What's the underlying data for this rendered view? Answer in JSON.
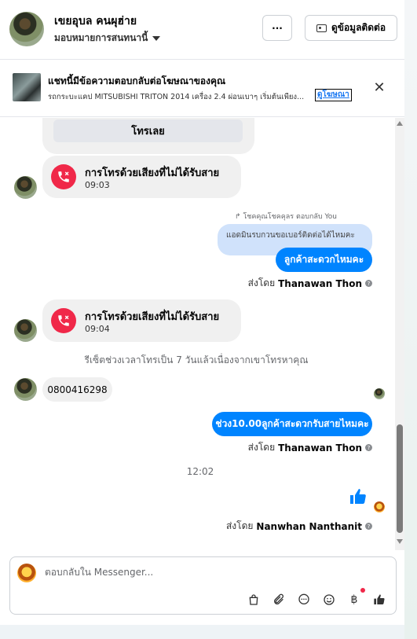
{
  "header": {
    "name": "เขยอุบล คนผุฮ่าย",
    "status": "มอบหมายการสนทนานี้",
    "more_label": "···",
    "contact_label": "ดูข้อมูลติดต่อ"
  },
  "ad_banner": {
    "title": "แชทนี้มีข้อความตอบกลับต่อโฆษณาของคุณ",
    "subtitle": "รถกระบะแคป MITSUBISHI TRITON 2014 เครื่อง 2.4 ผ่อนเบาๆ เริ่มต้นเพียง...",
    "link_label": "ดูโฆษณา",
    "close_label": "✕"
  },
  "thread": {
    "call_now_label": "โทรเลย",
    "missed_call_1": {
      "title": "การโทรด้วยเสียงที่ไม่ได้รับสาย",
      "time": "09:03"
    },
    "reply_context": "↱ โชคคุณโชคคุลร ตอบกลับ You",
    "quoted_text": "แอดมินรบกวนขอเบอร์ติดต่อได้ไหมคะ",
    "outgoing_1": "ลูกค้าสะดวกไหมคะ",
    "sent_by_1": {
      "prefix": "ส่งโดย",
      "name": "Thanawan Thon"
    },
    "missed_call_2": {
      "title": "การโทรด้วยเสียงที่ไม่ได้รับสาย",
      "time": "09:04"
    },
    "system_note": "รีเซ็ตช่วงเวลาโทรเป็น 7 วันแล้วเนื่องจากเขาโทรหาคุณ",
    "incoming_phone": "0800416298",
    "outgoing_2": "ช่วง10.00ลูกค้าสะดวกรับสายไหมคะ",
    "sent_by_2": {
      "prefix": "ส่งโดย",
      "name": "Thanawan Thon"
    },
    "time_separator": "12:02",
    "sent_by_3": {
      "prefix": "ส่งโดย",
      "name": "Nanwhan Nanthanit"
    }
  },
  "composer": {
    "placeholder": "ตอบกลับใน Messenger..."
  },
  "colors": {
    "accent": "#0084ff",
    "missed": "#f02849",
    "link": "#1877f2"
  }
}
